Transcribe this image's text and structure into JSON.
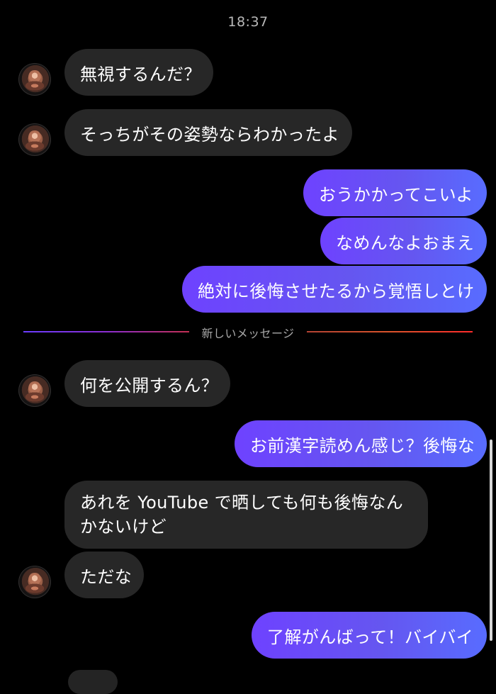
{
  "time": "18:37",
  "divider": {
    "label": "新しいメッセージ"
  },
  "messages": {
    "m1": "無視するんだ？",
    "m2": "そっちがその姿勢ならわかったよ",
    "m3": "おうかかってこいよ",
    "m4": "なめんなよおまえ",
    "m5": "絶対に後悔させたるから覚悟しとけ",
    "m6": "何を公開するん？",
    "m7": "お前漢字読めん感じ？後悔な",
    "m8": "あれを YouTube で晒しても何も後悔なんかないけど",
    "m9": "ただな",
    "m10": "了解がんばって！バイバイ"
  },
  "theme": {
    "sent_color_start": "#6e42ff",
    "sent_color_end": "#586cff",
    "received_color": "#272727"
  }
}
